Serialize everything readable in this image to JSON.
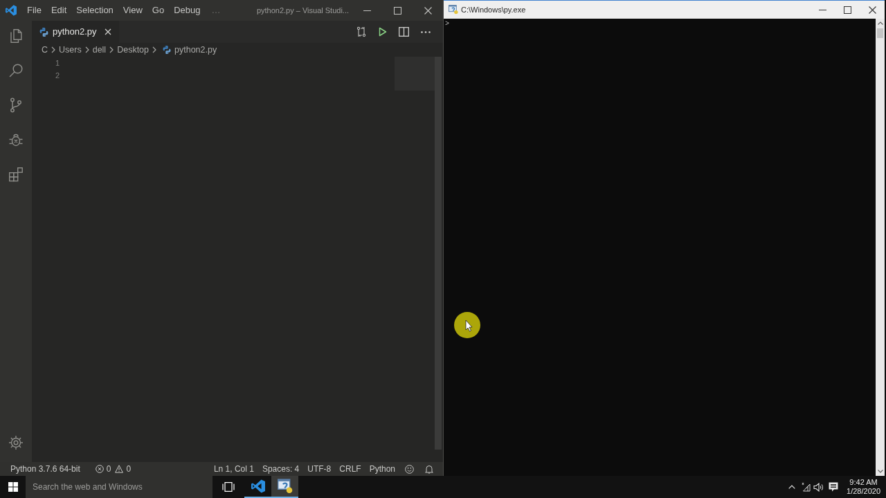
{
  "vscode": {
    "menu": [
      "File",
      "Edit",
      "Selection",
      "View",
      "Go",
      "Debug"
    ],
    "menu_overflow": "…",
    "title": "python2.py – Visual Studi...",
    "tabs": [
      {
        "label": "python2.py"
      }
    ],
    "breadcrumb": [
      {
        "label": "C",
        "kind": "folder"
      },
      {
        "label": "Users",
        "kind": "folder"
      },
      {
        "label": "dell",
        "kind": "folder"
      },
      {
        "label": "Desktop",
        "kind": "folder"
      },
      {
        "label": "python2.py",
        "kind": "file"
      }
    ],
    "line_numbers": [
      "1",
      "2"
    ],
    "status_bar": {
      "interpreter": "Python 3.7.6 64-bit",
      "errors": "0",
      "warnings": "0",
      "items": [
        "Ln 1, Col 1",
        "Spaces: 4",
        "UTF-8",
        "CRLF",
        "Python"
      ]
    }
  },
  "console": {
    "title": "C:\\Windows\\py.exe",
    "lines": [
      ">"
    ]
  },
  "taskbar": {
    "search": {
      "placeholder": "Search the web and Windows"
    },
    "apps": [
      {
        "kind": "vscode",
        "selected": false
      },
      {
        "kind": "console",
        "selected": true
      }
    ],
    "clock": {
      "time": "9:42 AM",
      "date": "1/28/2020"
    }
  }
}
